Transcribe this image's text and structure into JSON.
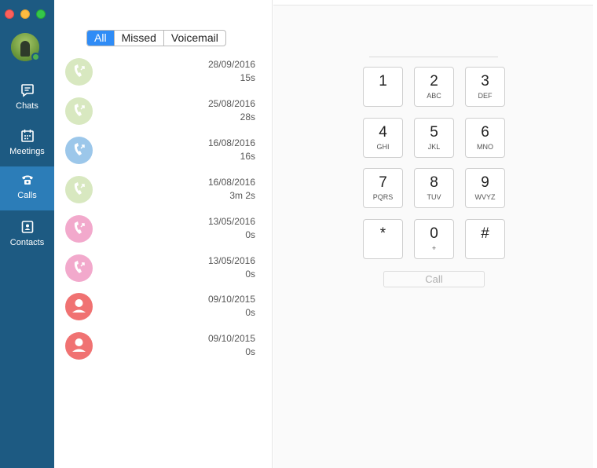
{
  "sidebar": {
    "items": [
      {
        "label": "Chats",
        "icon": "chat-icon"
      },
      {
        "label": "Meetings",
        "icon": "calendar-icon"
      },
      {
        "label": "Calls",
        "icon": "phone-icon",
        "active": true
      },
      {
        "label": "Contacts",
        "icon": "contact-card-icon"
      }
    ]
  },
  "filter": {
    "tabs": [
      {
        "label": "All",
        "selected": true
      },
      {
        "label": "Missed"
      },
      {
        "label": "Voicemail"
      }
    ]
  },
  "calls": [
    {
      "date": "28/09/2016",
      "duration": "15s",
      "kind": "phone-icon",
      "color": "#d8e8c0"
    },
    {
      "date": "25/08/2016",
      "duration": "28s",
      "kind": "phone-icon",
      "color": "#d8e8c0"
    },
    {
      "date": "16/08/2016",
      "duration": "16s",
      "kind": "phone-icon",
      "color": "#9cc7ea"
    },
    {
      "date": "16/08/2016",
      "duration": "3m 2s",
      "kind": "phone-icon",
      "color": "#d8e8c0"
    },
    {
      "date": "13/05/2016",
      "duration": "0s",
      "kind": "phone-icon",
      "color": "#f2a9cc"
    },
    {
      "date": "13/05/2016",
      "duration": "0s",
      "kind": "phone-icon",
      "color": "#f2a9cc"
    },
    {
      "date": "09/10/2015",
      "duration": "0s",
      "kind": "person-icon",
      "color": "#f07272"
    },
    {
      "date": "09/10/2015",
      "duration": "0s",
      "kind": "person-icon",
      "color": "#f07272"
    }
  ],
  "dialpad": {
    "keys": [
      {
        "digit": "1",
        "letters": ""
      },
      {
        "digit": "2",
        "letters": "ABC"
      },
      {
        "digit": "3",
        "letters": "DEF"
      },
      {
        "digit": "4",
        "letters": "GHI"
      },
      {
        "digit": "5",
        "letters": "JKL"
      },
      {
        "digit": "6",
        "letters": "MNO"
      },
      {
        "digit": "7",
        "letters": "PQRS"
      },
      {
        "digit": "8",
        "letters": "TUV"
      },
      {
        "digit": "9",
        "letters": "WVYZ"
      },
      {
        "digit": "*",
        "letters": ""
      },
      {
        "digit": "0",
        "letters": "+"
      },
      {
        "digit": "#",
        "letters": ""
      }
    ],
    "call_label": "Call"
  },
  "colors": {
    "sidebar": "#1d5a82",
    "active_nav": "#2c7db8",
    "segment_selected": "#2f8cf6"
  }
}
